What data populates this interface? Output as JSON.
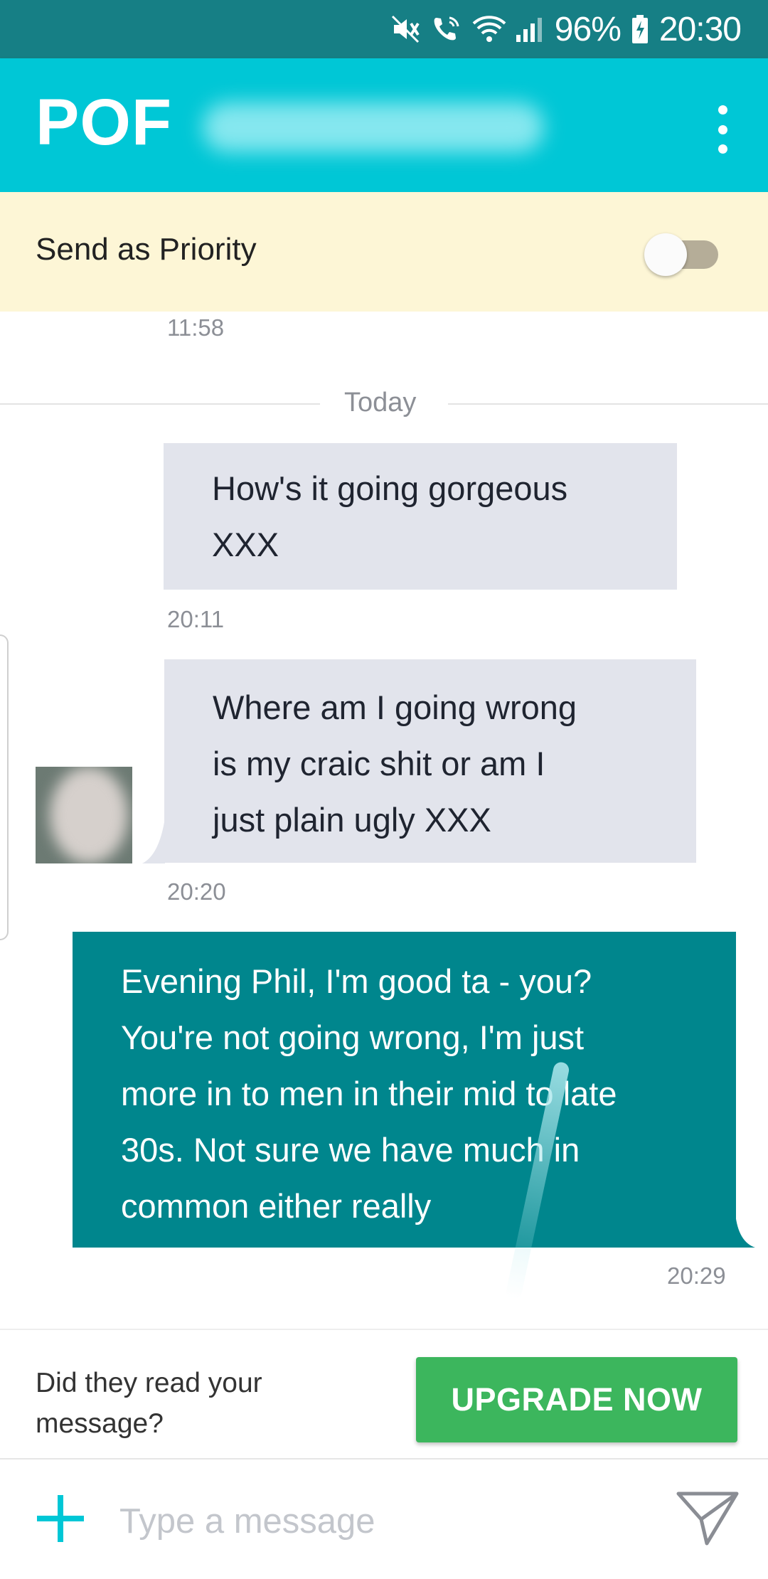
{
  "status_bar": {
    "battery": "96%",
    "time": "20:30",
    "icons": [
      "mute-icon",
      "wifi-calling-icon",
      "wifi-icon",
      "signal-icon",
      "battery-charging-icon"
    ]
  },
  "app_bar": {
    "logo": "POF",
    "menu_icon": "more-vert-icon"
  },
  "priority": {
    "label": "Send as Priority",
    "enabled": false
  },
  "conversation": {
    "earlier_timestamp": "11:58",
    "divider": "Today",
    "messages": [
      {
        "direction": "incoming",
        "lines": [
          "How's it going gorgeous",
          "XXX"
        ],
        "time": "20:11"
      },
      {
        "direction": "incoming",
        "lines": [
          "Where am I going wrong",
          "is my craic shit or am I",
          "just plain ugly XXX"
        ],
        "time": "20:20"
      },
      {
        "direction": "outgoing",
        "lines": [
          "Evening Phil, I'm good ta - you?",
          "You're not going wrong, I'm just",
          "more in to men in their mid to late",
          "30s.  Not sure we have much in",
          "common either really"
        ],
        "time": "20:29"
      }
    ]
  },
  "upgrade": {
    "prompt": "Did they read your message?",
    "prompt_line1": "Did they read your",
    "prompt_line2": "message?",
    "button": "UPGRADE NOW"
  },
  "composer": {
    "placeholder": "Type a message",
    "add_icon": "plus-icon",
    "send_icon": "send-icon"
  },
  "colors": {
    "status_bar": "#167f85",
    "app_bar": "#00c7d6",
    "priority_bg": "#fdf6d6",
    "incoming_bubble": "#e2e4ec",
    "outgoing_bubble": "#00868d",
    "upgrade_button": "#3cb65d",
    "accent": "#00c7d6"
  }
}
